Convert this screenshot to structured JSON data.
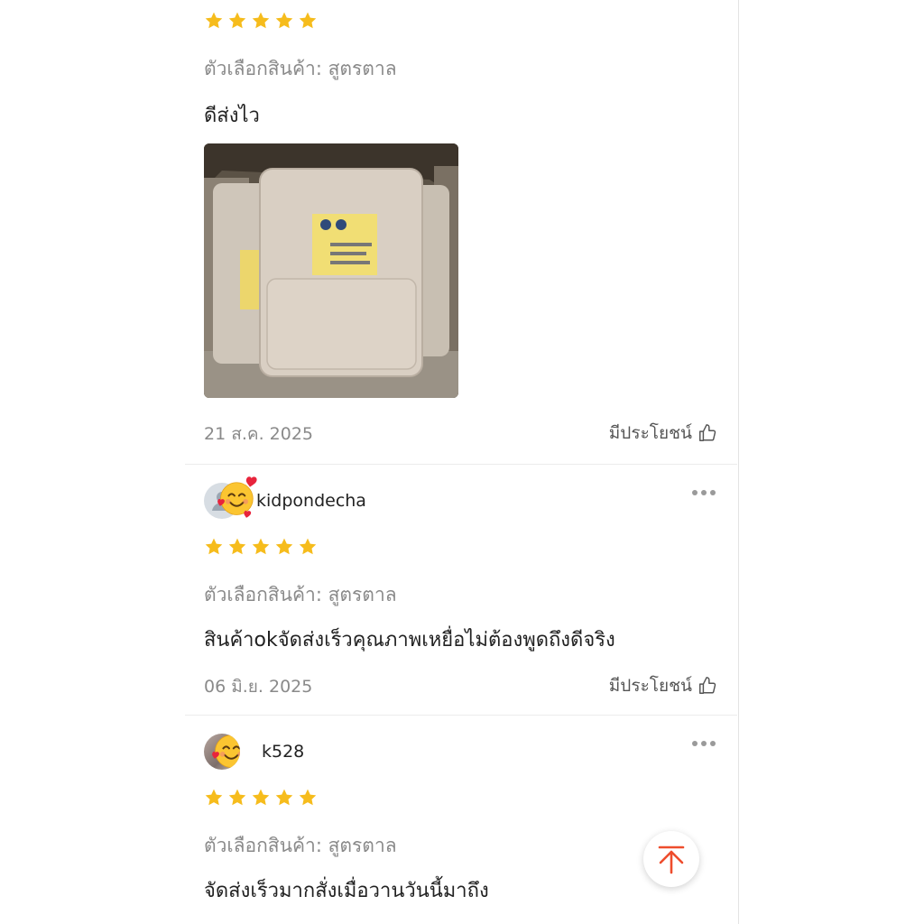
{
  "reviews": [
    {
      "rating": 5,
      "variant": "ตัวเลือกสินค้า: สูตรตาล",
      "text": "ดีส่งไว",
      "date": "21 ส.ค. 2025",
      "helpful_label": "มีประโยชน์",
      "has_photo": true
    },
    {
      "username": "kidpondecha",
      "rating": 5,
      "variant": "ตัวเลือกสินค้า: สูตรตาล",
      "text": "สินค้าokจัดส่งเร็วคุณภาพเหยื่อไม่ต้องพูดถึงดีจริง",
      "date": "06 มิ.ย. 2025",
      "helpful_label": "มีประโยชน์"
    },
    {
      "username": "k528",
      "rating": 5,
      "variant": "ตัวเลือกสินค้า: สูตรตาล",
      "text": "จัดส่งเร็วมากสั่งเมื่อวานวันนี้มาถึง"
    }
  ],
  "colors": {
    "star": "#F6BC1C",
    "accent": "#EE4D2D",
    "muted_text": "#8A8A8A",
    "divider": "#ECECEC"
  },
  "icons": {
    "star": "star-icon",
    "thumbs_up": "thumbs-up-icon",
    "more": "more-dots-icon",
    "scroll_top": "arrow-to-top-icon",
    "emoji": "smiling-face-with-hearts-emoji"
  }
}
